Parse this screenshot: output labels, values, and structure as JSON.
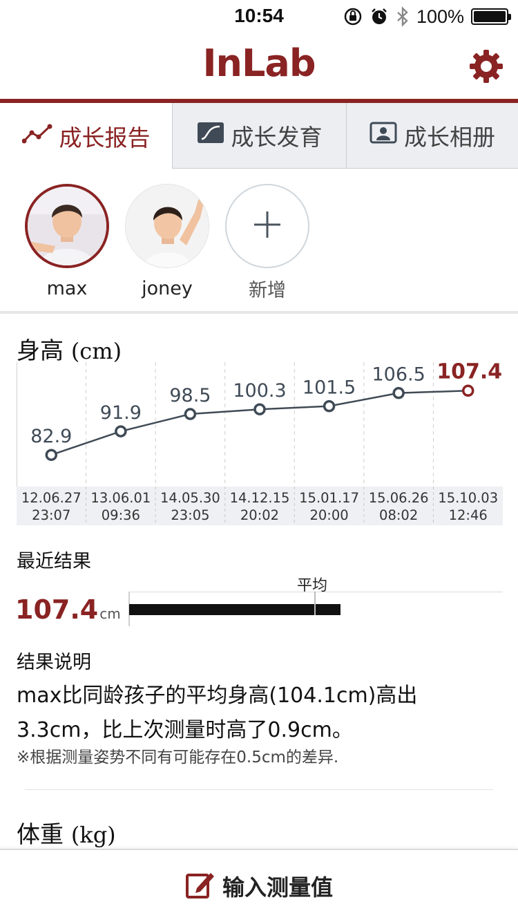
{
  "status": {
    "time": "10:54",
    "battery": "100%"
  },
  "header": {
    "logo": "InLab"
  },
  "tabs": [
    {
      "label": "成长报告",
      "icon": "trend-line-icon",
      "active": true
    },
    {
      "label": "成长发育",
      "icon": "growth-curve-icon",
      "active": false
    },
    {
      "label": "成长相册",
      "icon": "photo-album-icon",
      "active": false
    }
  ],
  "profiles": [
    {
      "name": "max",
      "selected": true
    },
    {
      "name": "joney",
      "selected": false
    },
    {
      "name": "新增",
      "type": "add"
    }
  ],
  "height": {
    "title": "身高",
    "unit": "(cm)",
    "latest_label": "最近结果",
    "latest_value": "107.4",
    "latest_unit": "cm",
    "average_label": "平均",
    "average_value": 104.1,
    "result_title": "结果说明",
    "result_text_1": "max比同龄孩子的平均身高(104.1cm)高出",
    "result_text_2": "3.3cm，比上次测量时高了0.9cm。",
    "note": "※根据测量姿势不同有可能存在0.5cm的差异."
  },
  "weight": {
    "title": "体重",
    "unit": "(kg)"
  },
  "bottom": {
    "label": "输入测量值"
  },
  "colors": {
    "accent": "#8a2323",
    "line": "#3f4a56",
    "tab_bg": "#eceef2"
  },
  "chart_data": {
    "type": "line",
    "title": "身高 (cm)",
    "x": [
      [
        "12.06.27",
        "23:07"
      ],
      [
        "13.06.01",
        "09:36"
      ],
      [
        "14.05.30",
        "23:05"
      ],
      [
        "14.12.15",
        "20:02"
      ],
      [
        "15.01.17",
        "20:00"
      ],
      [
        "15.06.26",
        "08:02"
      ],
      [
        "15.10.03",
        "12:46"
      ]
    ],
    "values": [
      82.9,
      91.9,
      98.5,
      100.3,
      101.5,
      106.5,
      107.4
    ],
    "value_labels": [
      "82.9",
      "91.9",
      "98.5",
      "100.3",
      "101.5",
      "106.5",
      "107.4"
    ],
    "highlight_last": true,
    "grid": "vertical-dashed"
  }
}
